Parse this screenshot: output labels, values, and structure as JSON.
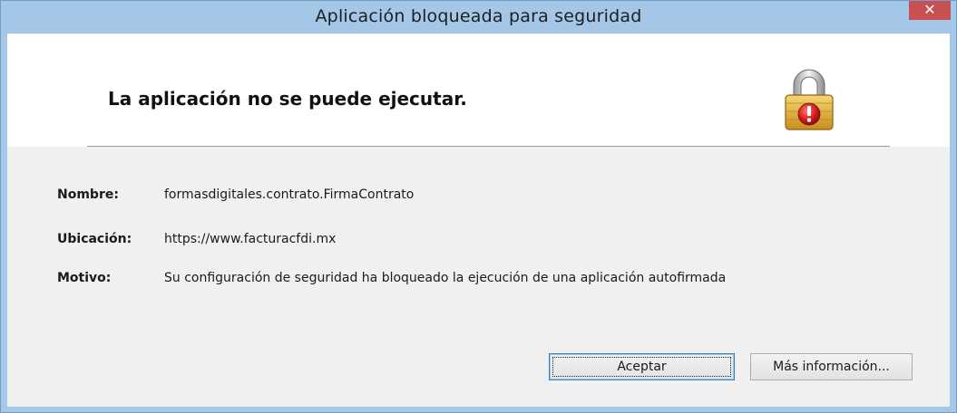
{
  "window": {
    "title": "Aplicación bloqueada para seguridad",
    "close_label": "✕"
  },
  "header": {
    "heading": "La aplicación no se puede ejecutar."
  },
  "details": [
    {
      "label": "Nombre:",
      "value": "formasdigitales.contrato.FirmaContrato"
    },
    {
      "label": "Ubicación:",
      "value": "https://www.facturacfdi.mx"
    },
    {
      "label": "Motivo:",
      "value": "Su configuración de seguridad ha bloqueado la ejecución de una aplicación autofirmada"
    }
  ],
  "buttons": {
    "accept_label": "Aceptar",
    "more_info_label": "Más información..."
  },
  "icons": {
    "lock": "padlock-warning-icon",
    "close": "close-icon"
  },
  "colors": {
    "titlebar": "#a5c7e7",
    "close_button": "#c75050",
    "lock_gold": "#e3b23c",
    "warning_red": "#d62020"
  }
}
